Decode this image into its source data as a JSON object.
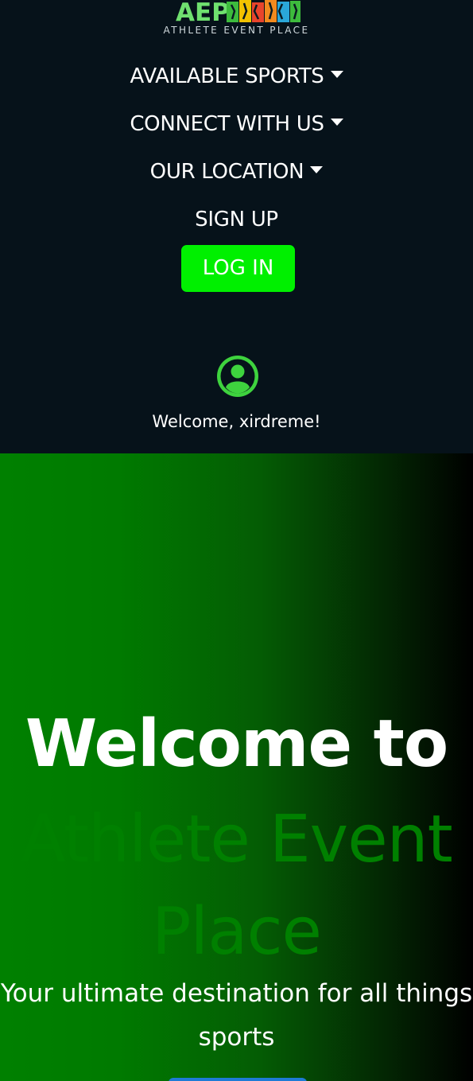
{
  "brand": {
    "logo_text": "AEP",
    "tagline": "ATHLETE EVENT PLACE"
  },
  "nav": {
    "items": [
      {
        "label": "AVAILABLE SPORTS"
      },
      {
        "label": "CONNECT WITH US"
      },
      {
        "label": "OUR LOCATION"
      },
      {
        "label": "SIGN UP"
      }
    ],
    "login_label": "LOG IN"
  },
  "user": {
    "welcome": "Welcome, xirdreme!"
  },
  "hero": {
    "title_line1": "Welcome to",
    "title_line2": "Athlete Event Place",
    "subtitle": "Your ultimate destination for all things sports"
  },
  "colors": {
    "nav_bg": "#06121a",
    "login_button": "#00f000",
    "avatar_accent": "#3ed33e",
    "hero_green": "#008000",
    "cta_blue": "#1e7bd6"
  },
  "icons": {
    "user_avatar": "user-circle-icon",
    "dropdown": "caret-down-icon"
  }
}
